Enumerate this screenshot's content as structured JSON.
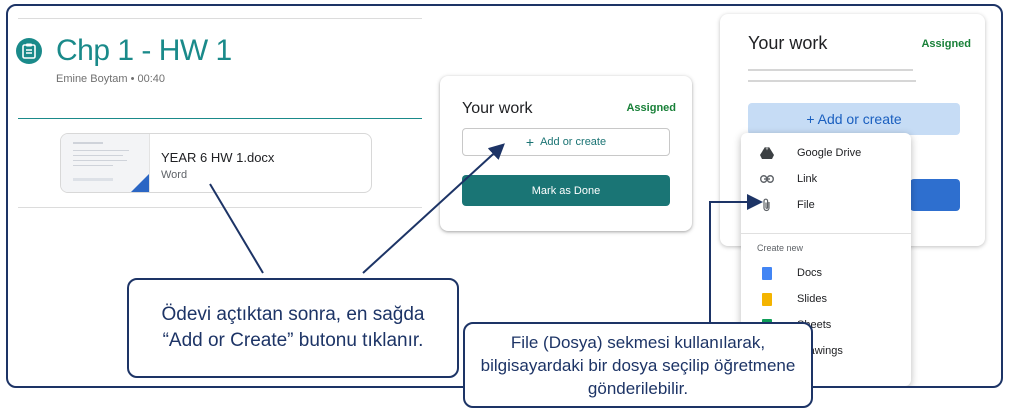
{
  "assignment": {
    "title": "Chp 1 - HW 1",
    "meta": "Emine Boytam • 00:40",
    "attachment": {
      "name": "YEAR 6 HW 1.docx",
      "type": "Word"
    }
  },
  "your_work_small": {
    "title": "Your work",
    "status": "Assigned",
    "add_plus": "+",
    "add_label": "Add or create",
    "done_label": "Mark as Done"
  },
  "your_work_large": {
    "title": "Your work",
    "status": "Assigned",
    "add_label": "+ Add or create"
  },
  "menu": {
    "items": [
      {
        "label": "Google Drive",
        "icon": "google-drive-icon"
      },
      {
        "label": "Link",
        "icon": "link-icon"
      },
      {
        "label": "File",
        "icon": "paperclip-icon"
      }
    ],
    "create_header": "Create new",
    "create_items": [
      {
        "label": "Docs",
        "icon": "docs-icon",
        "color": "#4285f4"
      },
      {
        "label": "Slides",
        "icon": "slides-icon",
        "color": "#f4b400"
      },
      {
        "label": "Sheets",
        "icon": "sheets-icon",
        "color": "#0f9d58"
      },
      {
        "label": "Drawings",
        "icon": "drawings-icon",
        "color": "#db4437"
      }
    ]
  },
  "callouts": {
    "left": "Ödevi açtıktan sonra, en sağda “Add or Create” butonu tıklanır.",
    "right": "File (Dosya) sekmesi kullanılarak, bilgisayardaki bir dosya seçilip öğretmene gönderilebilir."
  },
  "colors": {
    "teal": "#1a8a8a",
    "navy": "#1d3466",
    "assigned_green": "#188038",
    "add_blue_bg": "#c6dcf5"
  }
}
